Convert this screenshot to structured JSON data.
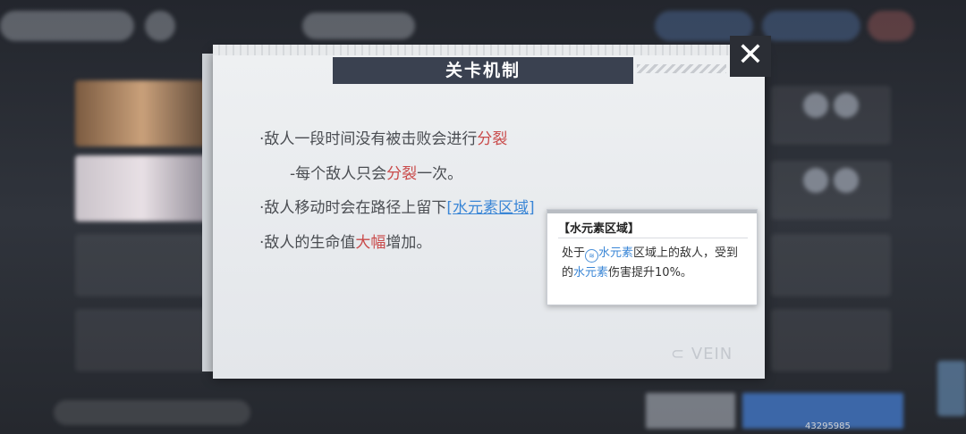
{
  "popup": {
    "title": "关卡机制",
    "close_label": "✕",
    "mechanics": [
      {
        "prefix": "·敌人一段时间没有被击败会进行",
        "highlight": "分裂",
        "suffix": ""
      },
      {
        "prefix": "-每个敌人只会",
        "highlight": "分裂",
        "suffix": "一次。"
      },
      {
        "prefix": "·敌人移动时会在路径上留下",
        "link": "[水元素区域]",
        "suffix": ""
      },
      {
        "prefix": "·敌人的生命值",
        "highlight": "大幅",
        "suffix": "增加。"
      }
    ],
    "watermark": "VEIN"
  },
  "tooltip": {
    "title": "【水元素区域】",
    "body_1": "处于",
    "body_term_1": "水元素",
    "body_2": "区域上的敌人，受到的",
    "body_term_2": "水元素",
    "body_3": "伤害提升10%。"
  },
  "footer": {
    "id": "43295985"
  },
  "colors": {
    "highlight_red": "#c94a4a",
    "link_blue": "#3a86d6",
    "title_bar": "#3a4150"
  }
}
